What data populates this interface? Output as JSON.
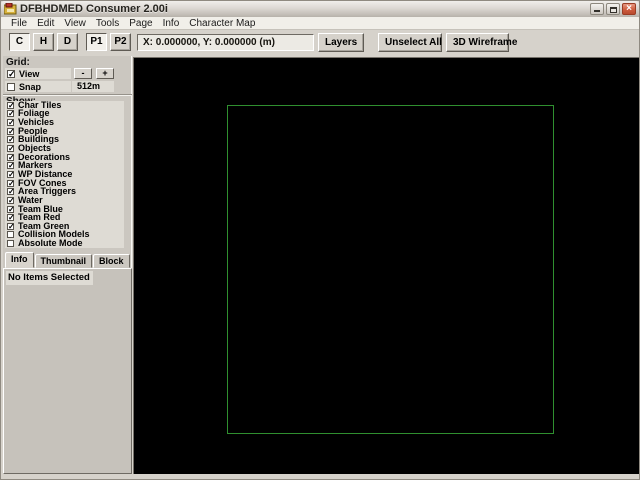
{
  "window": {
    "title": "DFBHDMED Consumer 2.00i"
  },
  "icons": {
    "close": "×",
    "check": "✓",
    "minimize": "_",
    "restore": "❐"
  },
  "menu": {
    "items": [
      "File",
      "Edit",
      "View",
      "Tools",
      "Page",
      "Info",
      "Character Map"
    ]
  },
  "toolbar": {
    "mode_buttons": [
      {
        "label": "C",
        "active": true
      },
      {
        "label": "H",
        "active": false
      },
      {
        "label": "D",
        "active": false
      }
    ],
    "page_buttons": [
      {
        "label": "P1",
        "active": true
      },
      {
        "label": "P2",
        "active": false
      }
    ],
    "coords": "X: 0.000000, Y: 0.000000 (m)",
    "buttons": [
      "Layers",
      "Unselect All",
      "3D Wireframe"
    ]
  },
  "sidebar": {
    "grid": {
      "label": "Grid:",
      "view": {
        "label": "View",
        "checked": true
      },
      "snap": {
        "label": "Snap",
        "checked": false
      },
      "zoom_out": "-",
      "zoom_in": "+",
      "snap_value": "512m"
    },
    "show": {
      "label": "Show:",
      "items": [
        {
          "label": "Char Tiles",
          "checked": true
        },
        {
          "label": "Foliage",
          "checked": true
        },
        {
          "label": "Vehicles",
          "checked": true
        },
        {
          "label": "People",
          "checked": true
        },
        {
          "label": "Buildings",
          "checked": true
        },
        {
          "label": "Objects",
          "checked": true
        },
        {
          "label": "Decorations",
          "checked": true
        },
        {
          "label": "Markers",
          "checked": true
        },
        {
          "label": "WP Distance",
          "checked": true
        },
        {
          "label": "FOV Cones",
          "checked": true
        },
        {
          "label": "Area Triggers",
          "checked": true
        },
        {
          "label": "Water",
          "checked": true
        },
        {
          "label": "Team Blue",
          "checked": true
        },
        {
          "label": "Team Red",
          "checked": true
        },
        {
          "label": "Team Green",
          "checked": true
        },
        {
          "label": "Collision Models",
          "checked": false
        },
        {
          "label": "Absolute Mode",
          "checked": false
        }
      ]
    },
    "tabs": [
      {
        "label": "Info",
        "active": true
      },
      {
        "label": "Thumbnail",
        "active": false
      },
      {
        "label": "Block",
        "active": false
      }
    ],
    "info_panel": {
      "message": "No Items Selected"
    }
  },
  "canvas": {
    "background": "#000000",
    "outline_color": "#2f8f2f"
  }
}
